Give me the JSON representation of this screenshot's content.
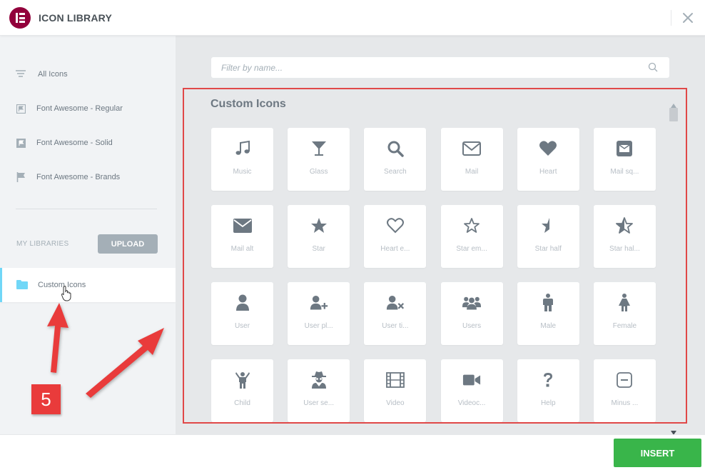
{
  "header": {
    "title": "ICON LIBRARY"
  },
  "sidebar": {
    "items": [
      {
        "label": "All Icons",
        "icon": "list-icon"
      },
      {
        "label": "Font Awesome - Regular",
        "icon": "flag-icon"
      },
      {
        "label": "Font Awesome - Solid",
        "icon": "flag-icon"
      },
      {
        "label": "Font Awesome - Brands",
        "icon": "flag-icon"
      }
    ],
    "my_libraries_label": "MY LIBRARIES",
    "upload_label": "UPLOAD",
    "custom_library_label": "Custom Icons"
  },
  "main": {
    "search_placeholder": "Filter by name...",
    "section_title": "Custom Icons",
    "icons": [
      {
        "name": "Music",
        "icon": "music-icon"
      },
      {
        "name": "Glass",
        "icon": "glass-icon"
      },
      {
        "name": "Search",
        "icon": "search-icon"
      },
      {
        "name": "Mail",
        "icon": "mail-icon"
      },
      {
        "name": "Heart",
        "icon": "heart-icon"
      },
      {
        "name": "Mail sq...",
        "icon": "mail-square-icon"
      },
      {
        "name": "Mail alt",
        "icon": "mail-alt-icon"
      },
      {
        "name": "Star",
        "icon": "star-icon"
      },
      {
        "name": "Heart e...",
        "icon": "heart-empty-icon"
      },
      {
        "name": "Star em...",
        "icon": "star-empty-icon"
      },
      {
        "name": "Star half",
        "icon": "star-half-icon"
      },
      {
        "name": "Star hal...",
        "icon": "star-half-alt-icon"
      },
      {
        "name": "User",
        "icon": "user-icon"
      },
      {
        "name": "User pl...",
        "icon": "user-plus-icon"
      },
      {
        "name": "User ti...",
        "icon": "user-times-icon"
      },
      {
        "name": "Users",
        "icon": "users-icon"
      },
      {
        "name": "Male",
        "icon": "male-icon"
      },
      {
        "name": "Female",
        "icon": "female-icon"
      },
      {
        "name": "Child",
        "icon": "child-icon"
      },
      {
        "name": "User se...",
        "icon": "user-secret-icon"
      },
      {
        "name": "Video",
        "icon": "video-icon"
      },
      {
        "name": "Videoc...",
        "icon": "videocam-icon"
      },
      {
        "name": "Help",
        "icon": "help-icon"
      },
      {
        "name": "Minus ...",
        "icon": "minus-square-icon"
      }
    ]
  },
  "footer": {
    "insert_label": "INSERT"
  },
  "annotation": {
    "step_number": "5"
  },
  "colors": {
    "brand": "#92003b",
    "accent": "#71d7f7",
    "insert": "#39b54a",
    "annotation": "#e93b3b"
  }
}
